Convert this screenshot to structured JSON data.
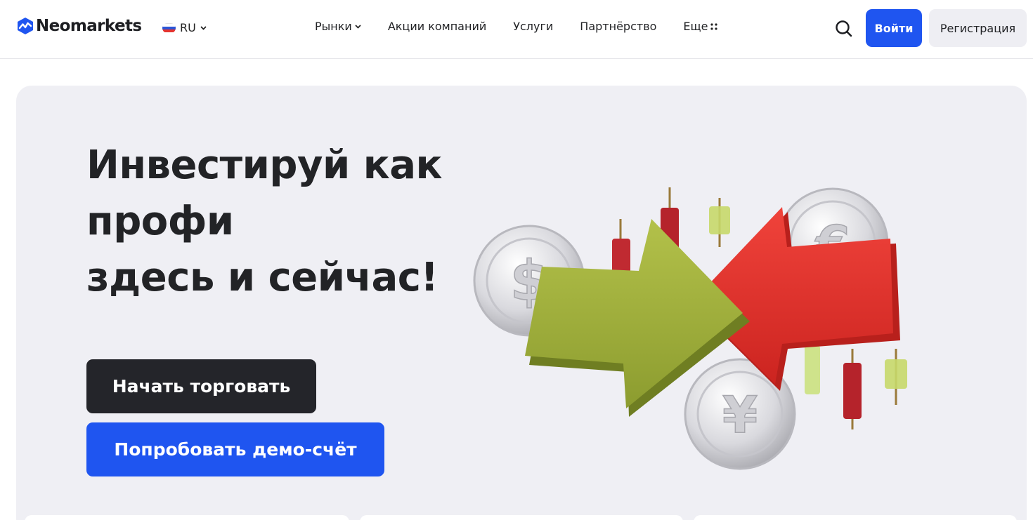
{
  "header": {
    "logo_text": "Neomarkets",
    "language": "RU",
    "nav": [
      {
        "label": "Рынки",
        "has_dropdown": true
      },
      {
        "label": "Акции компаний"
      },
      {
        "label": "Услуги"
      },
      {
        "label": "Партнёрство"
      },
      {
        "label": "Еще",
        "icon": "dots-grid-icon"
      }
    ],
    "login_label": "Войти",
    "register_label": "Регистрация"
  },
  "hero": {
    "title_lines": [
      "Инвестируй как",
      "профи",
      "здесь и сейчас!"
    ],
    "primary_button": "Начать торговать",
    "secondary_button": "Попробовать демо-счёт",
    "illustration_icons": [
      "dollar-coin-icon",
      "euro-coin-icon",
      "yen-coin-icon",
      "green-arrow-icon",
      "red-arrow-icon",
      "candlestick-icon"
    ]
  },
  "colors": {
    "brand_blue": "#1f55f0",
    "dark": "#24252a",
    "hero_bg": "#efeff4",
    "arrow_green": "#9aab3a",
    "arrow_red": "#e8322e"
  }
}
